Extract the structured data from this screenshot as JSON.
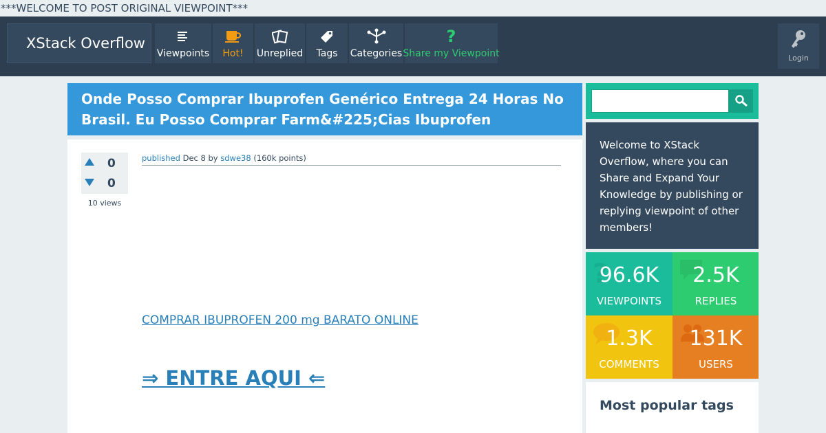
{
  "banner": "***WELCOME TO POST ORIGINAL VIEWPOINT***",
  "header": {
    "logo": "XStack Overflow",
    "nav": [
      {
        "label": "Viewpoints",
        "icon": "list-icon"
      },
      {
        "label": "Hot!",
        "icon": "coffee-cup-icon"
      },
      {
        "label": "Unreplied",
        "icon": "documents-icon"
      },
      {
        "label": "Tags",
        "icon": "tag-icon"
      },
      {
        "label": "Categories",
        "icon": "hierarchy-icon"
      },
      {
        "label": "Share my Viewpoint",
        "icon": "question-mark-icon"
      }
    ],
    "login": {
      "label": "Login",
      "icon": "key-icon"
    }
  },
  "question": {
    "title": "Onde Posso Comprar Ibuprofen Genérico Entrega 24 Horas No Brasil. Eu Posso Comprar Farm&#225;Cias Ibuprofen",
    "upvotes": "0",
    "downvotes": "0",
    "views": "10 views",
    "meta": {
      "published": "published",
      "date": "Dec 8",
      "by": "by",
      "author": "sdwe38",
      "points": "(160k points)"
    },
    "buy_link": "COMPRAR IBUPROFEN 200 mg BARATO ONLINE",
    "enter_link": "⇒ ENTRE AQUI ⇐"
  },
  "sidebar": {
    "search": {
      "value": "",
      "placeholder": ""
    },
    "welcome": "Welcome to XStack Overflow, where you can Share and Expand Your Knowledge by publishing or replying viewpoint of other members!",
    "stats": [
      {
        "value": "96.6K",
        "label": "VIEWPOINTS",
        "color": "#1abc9c"
      },
      {
        "value": "2.5K",
        "label": "REPLIES",
        "color": "#2ecc71"
      },
      {
        "value": "1.3K",
        "label": "COMMENTS",
        "color": "#f1c40f"
      },
      {
        "value": "131K",
        "label": "USERS",
        "color": "#e67e22"
      }
    ],
    "tags_title": "Most popular tags"
  }
}
